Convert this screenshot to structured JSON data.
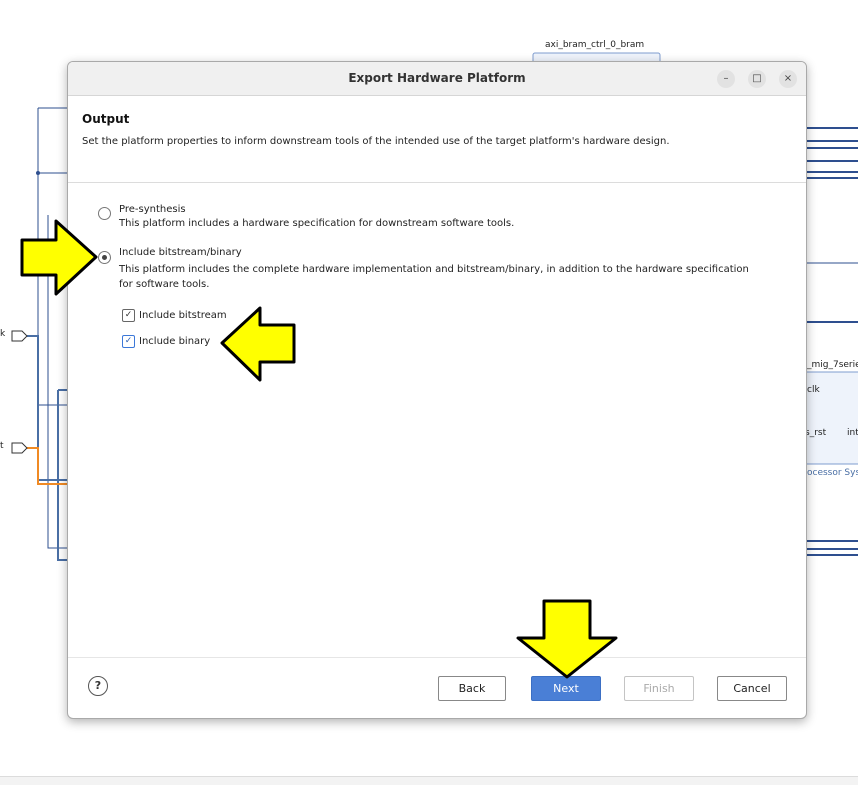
{
  "dialog": {
    "title": "Export Hardware Platform",
    "controls": {
      "minimize": "–",
      "maximize": "□",
      "close": "×"
    },
    "section_title": "Output",
    "section_description": "Set the platform properties to inform downstream tools of the intended use of the target platform's hardware design.",
    "options": [
      {
        "label": "Pre-synthesis",
        "description": "This platform includes a hardware specification for downstream software tools.",
        "selected": false
      },
      {
        "label": "Include bitstream/binary",
        "description_line1": "This platform includes the complete hardware implementation and bitstream/binary, in addition to the hardware specification",
        "description_line2": "for software tools.",
        "selected": true
      }
    ],
    "checkboxes": [
      {
        "label": "Include bitstream",
        "checked": true
      },
      {
        "label": "Include binary",
        "checked": true
      }
    ],
    "buttons": {
      "help": "?",
      "back": "Back",
      "next": "Next",
      "finish": "Finish",
      "cancel": "Cancel"
    }
  },
  "background": {
    "top_block_label": "axi_bram_ctrl_0_bram",
    "right_block_title": "_mig_7serie",
    "right_block_pin_clk": "clk",
    "right_block_pin_rst": "s_rst",
    "right_block_pin_int": "int",
    "right_block_footer": "ocessor Sys",
    "left_port_1": "k",
    "left_port_2": "t"
  },
  "colors": {
    "primary_button": "#4a7fd6",
    "arrow_fill": "#ffff00",
    "wire_blue": "#2e4f8f",
    "wire_orange": "#f08a24"
  }
}
